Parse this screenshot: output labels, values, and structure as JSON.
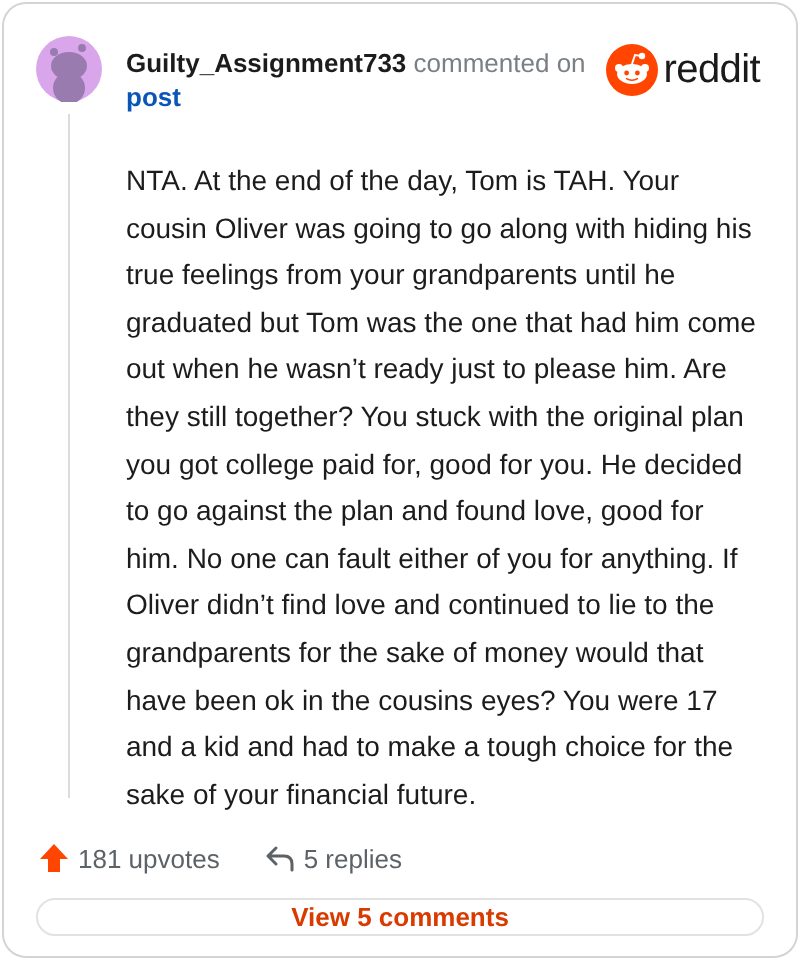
{
  "comment": {
    "author": "Guilty_Assignment733",
    "action": "commented on",
    "target": "post",
    "body": "NTA. At the end of the day, Tom is TAH. Your cousin Oliver was going to go along with hiding his true feelings from your grandparents until he graduated but Tom was the one that had him come out when he wasn’t ready just to please him. Are they still together? You stuck with the original plan you got college paid for, good for you. He decided to go against the plan and found love, good for him. No one can fault either of you for anything. If Oliver didn’t find love and continued to lie to the grandparents for the sake of money would that have been ok in the cousins eyes? You were 17 and a kid and had to make a tough choice for the sake of your financial future."
  },
  "logo": {
    "wordmark": "reddit"
  },
  "stats": {
    "upvotes": "181 upvotes",
    "replies": "5 replies"
  },
  "button": {
    "label": "View 5 comments"
  }
}
